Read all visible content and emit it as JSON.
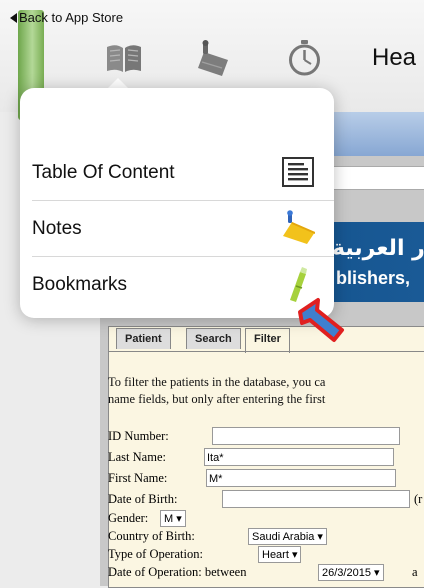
{
  "statusbar": {
    "back_label": "Back to App Store"
  },
  "toolbar": {
    "title": "Hea",
    "icons": [
      "book-icon",
      "bookmark-stamp-icon",
      "stopwatch-icon"
    ]
  },
  "popover": {
    "items": [
      {
        "label": "Table Of Content",
        "icon": "table-of-contents-icon"
      },
      {
        "label": "Notes",
        "icon": "notes-icon"
      },
      {
        "label": "Bookmarks",
        "icon": "bookmarks-icon"
      }
    ]
  },
  "webpage": {
    "banner": {
      "arabic": "ر العربية",
      "english": "blishers,"
    },
    "tabs": [
      {
        "label": "Patient",
        "active": false
      },
      {
        "label": "Search",
        "active": false
      },
      {
        "label": "Filter",
        "active": true
      }
    ],
    "filter_text": [
      "To filter the patients in the database, you ca",
      "name fields, but only after entering the first"
    ],
    "form": {
      "id_number": {
        "label": "ID Number:",
        "value": ""
      },
      "last_name": {
        "label": "Last Name:",
        "value": "Ita*"
      },
      "first_name": {
        "label": "First Name:",
        "value": "M*"
      },
      "dob": {
        "label": "Date of Birth:",
        "value": "",
        "suffix": "(r"
      },
      "gender": {
        "label": "Gender:",
        "value": "M ▾"
      },
      "country": {
        "label": "Country of Birth:",
        "value": "Saudi Arabia ▾"
      },
      "operation_type": {
        "label": "Type of Operation:",
        "value": "Heart ▾"
      },
      "operation_date": {
        "label": "Date of Operation: between",
        "value": "26/3/2015 ▾",
        "suffix": "a"
      }
    }
  },
  "colors": {
    "banner": "#0d4c85",
    "arrow_fill": "#3f7fcf",
    "arrow_outline": "#e02020",
    "form_bg": "#fbf6e2"
  }
}
